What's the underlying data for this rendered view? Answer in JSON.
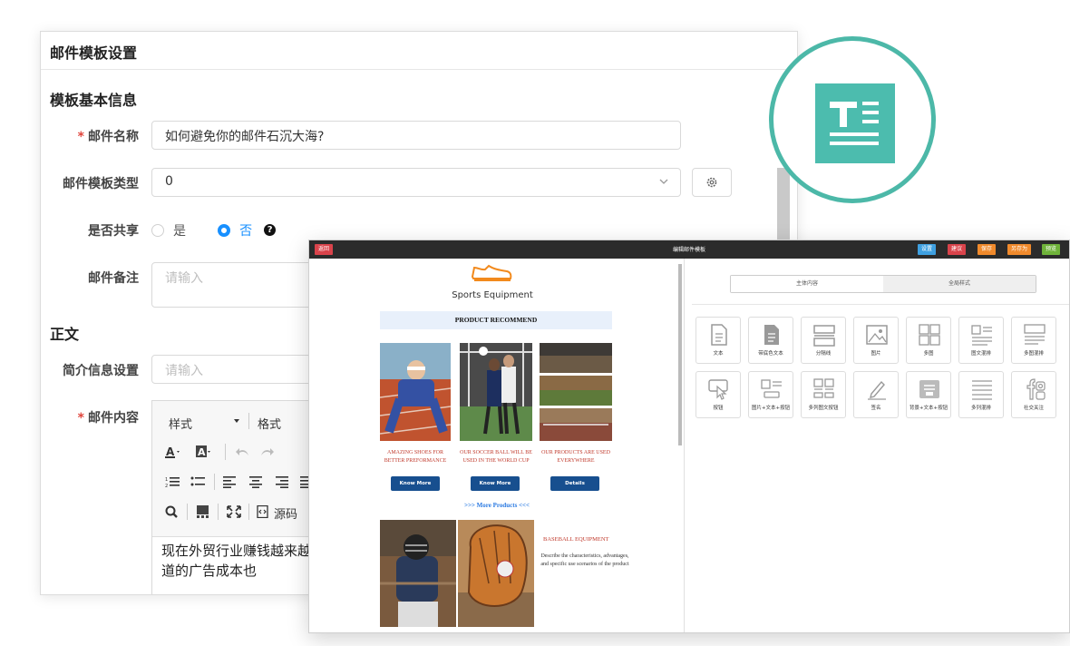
{
  "settings": {
    "title": "邮件模板设置",
    "section_basic": "模板基本信息",
    "name_label": "邮件名称",
    "name_value": "如何避免你的邮件石沉大海?",
    "type_label": "邮件模板类型",
    "type_value": "0",
    "share_label": "是否共享",
    "share_yes": "是",
    "share_no": "否",
    "help_icon_text": "?",
    "remark_label": "邮件备注",
    "remark_placeholder": "请输入",
    "section_body": "正文",
    "intro_label": "简介信息设置",
    "intro_placeholder": "请输入",
    "content_label": "邮件内容",
    "toolbar": {
      "style_label": "样式",
      "format_label": "格式",
      "source_label": "源码"
    },
    "content_text": "现在外贸行业赚钱越来越难，利润越来越低。那原因是什么？主要是竞争对手多了，渠道的广告成本也",
    "colors": {
      "required": "#e0453c",
      "accent": "#1890ff"
    }
  },
  "editor": {
    "window_title": "编辑邮件模板",
    "back_button": "返回",
    "buttons": [
      {
        "label": "设置",
        "color": "#3fa0e0"
      },
      {
        "label": "建议",
        "color": "#d9434b"
      },
      {
        "label": "保存",
        "color": "#f08a2c"
      },
      {
        "label": "另存为",
        "color": "#f08a2c"
      },
      {
        "label": "预览",
        "color": "#6fb33a"
      }
    ],
    "preview": {
      "brand": "Sports Equipment",
      "heading": "PRODUCT RECOMMEND",
      "products": [
        {
          "caption": "AMAZING SHOES FOR BETTER PREFORMANCE",
          "button": "Know More"
        },
        {
          "caption": "OUR SOCCER BALL WILL BE USED IN THE WORLD CUP",
          "button": "Know More"
        },
        {
          "caption": "OUR PRODUCTS ARE USED EVERYWHERE",
          "button": "Details"
        }
      ],
      "more_link": ">>> More Products <<<",
      "feature_title": "BASEBALL EQUIPMENT",
      "feature_desc": "Describe the characteristics, advantages, and specific use scenarios of the product"
    },
    "sidebar": {
      "tabs": [
        "主体内容",
        "全局样式"
      ],
      "tools": [
        "文本",
        "带底色文本",
        "分隔线",
        "图片",
        "多图",
        "图文混排",
        "多图混排",
        "按钮",
        "图片+文本+按钮",
        "多列图文按钮",
        "签名",
        "背景+文本+按钮",
        "多列混排",
        "社交关注"
      ]
    }
  },
  "badge": {
    "icon": "text-align-icon",
    "color": "#4cbcae"
  }
}
